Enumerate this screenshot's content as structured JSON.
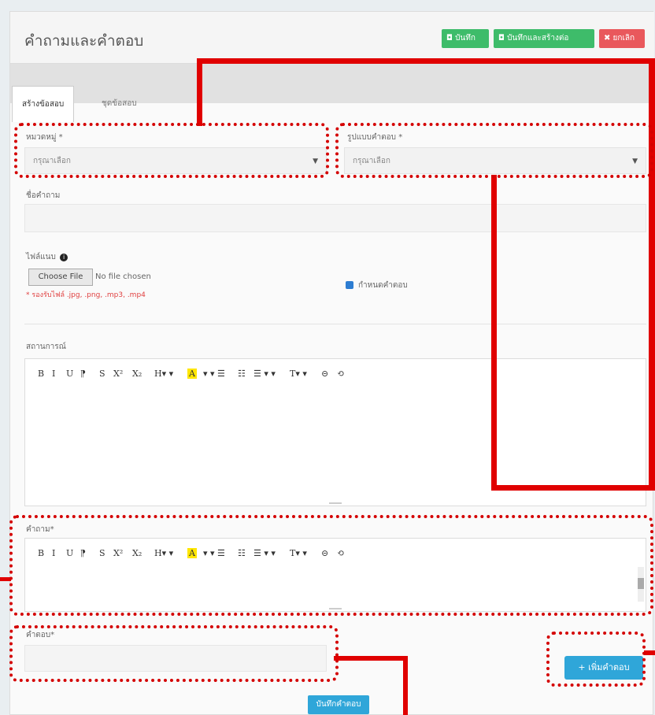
{
  "header": {
    "title": "คำถามและคำตอบ",
    "buttons": [
      {
        "label": "◘ บันทึก",
        "color": "#3ebc6a"
      },
      {
        "label": "◘ บันทึกและสร้างต่อ",
        "color": "#3ebc6a"
      },
      {
        "label": "✖ ยกเลิก",
        "color": "#e9585c"
      }
    ]
  },
  "tabs": [
    {
      "label": "สร้างข้อสอบ",
      "active": true
    },
    {
      "label": "ชุดข้อสอบ",
      "active": false
    }
  ],
  "form": {
    "category_label": "หมวดหมู่ *",
    "category_value": "กรุณาเลือก",
    "answer_type_label": "รูปแบบคำตอบ *",
    "answer_type_value": "กรุณาเลือก",
    "question_title_label": "ชื่อคำถาม",
    "file_label": "ไฟล์แนบ",
    "file_button": "Choose File",
    "file_status": "No file chosen",
    "file_hint": "* รองรับไฟล์ .jpg, .png, .mp3, .mp4",
    "checkbox_label": "กำหนดคำตอบ",
    "scenario_label": "สถานการณ์",
    "question_label": "คำถาม*",
    "answer_label": "คำตอบ*",
    "add_answer_button": "+ เพิ่มคำตอบ",
    "save_button": "บันทึกคำตอบ"
  },
  "toolbar": {
    "items": [
      "B",
      "I",
      "U",
      "⁋",
      "S",
      "X²",
      "X₂",
      "H▾ ▾",
      "A",
      "▾ ▾ ☰",
      "☷",
      "☰ ▾ ▾",
      "T▾ ▾",
      "⊝",
      "⟲"
    ]
  },
  "annotation_color": "#d40000"
}
